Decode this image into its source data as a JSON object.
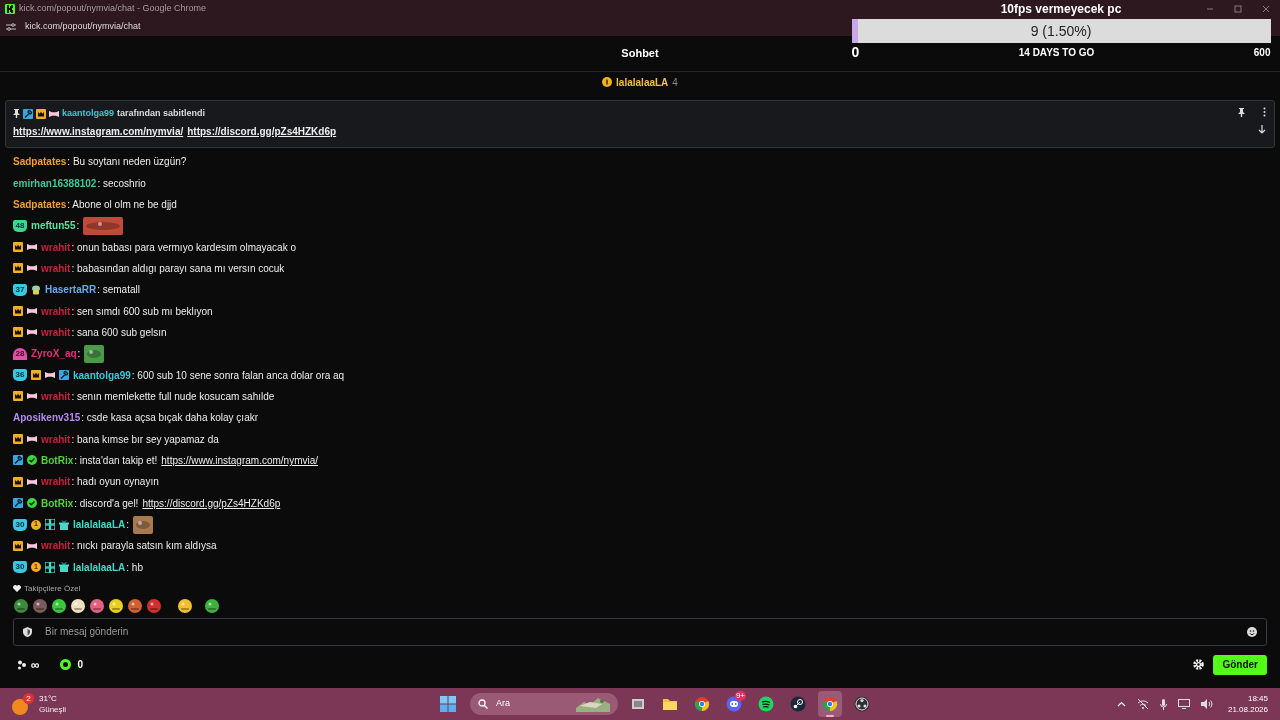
{
  "browser": {
    "title": "kick.com/popout/nymvia/chat - Google Chrome",
    "url": "kick.com/popout/nymvia/chat"
  },
  "goal": {
    "title": "10fps vermeyecek pc",
    "reading": "9 (1.50%)",
    "level": 0.015,
    "min": "0",
    "remaining": "14 DAYS TO GO",
    "max": "600"
  },
  "header": {
    "title": "Sohbet"
  },
  "gifter": {
    "name": "lalalalaaLA",
    "count": "4"
  },
  "pinned": {
    "badges": [
      {
        "kind": "mod"
      },
      {
        "kind": "crown"
      },
      {
        "kind": "ribbon"
      }
    ],
    "user": "kaantolga99",
    "color": "#3cc8d8",
    "note": "tarafından sabitlendi",
    "links": [
      "https://www.instagram.com/nymvia/",
      "https://discord.gg/pZs4HZKd6p"
    ]
  },
  "messages": [
    {
      "user": "Sadpatates",
      "color": "#f0a030",
      "text": ": Bu soytanı neden üzgün?"
    },
    {
      "user": "emirhan16388102",
      "color": "#3fc89a",
      "text": ": secoshrio"
    },
    {
      "user": "Sadpatates",
      "color": "#f0a030",
      "text": ": Abone ol olm ne be djjd"
    },
    {
      "badges": [
        {
          "kind": "sub",
          "label": "48",
          "color": "#3cd890"
        }
      ],
      "user": "meftun55",
      "color": "#5de0a0",
      "text": ":",
      "emote": {
        "color": "#c04a3a"
      }
    },
    {
      "badges": [
        {
          "kind": "crown"
        },
        {
          "kind": "ribbon"
        }
      ],
      "user": "wrahit",
      "color": "#c8203c",
      "text": ": onun babası para vermıyo kardesım olmayacak o"
    },
    {
      "badges": [
        {
          "kind": "crown"
        },
        {
          "kind": "ribbon"
        }
      ],
      "user": "wrahit",
      "color": "#c8203c",
      "text": ": babasından aldıgı parayı sana mı versın cocuk"
    },
    {
      "badges": [
        {
          "kind": "sub",
          "label": "37",
          "color": "#38c8e0"
        },
        {
          "kind": "alien"
        }
      ],
      "user": "HasertaRR",
      "color": "#6aa8f0",
      "text": ": sematall"
    },
    {
      "badges": [
        {
          "kind": "crown"
        },
        {
          "kind": "ribbon"
        }
      ],
      "user": "wrahit",
      "color": "#c8203c",
      "text": ": sen sımdı 600 sub mı beklıyon"
    },
    {
      "badges": [
        {
          "kind": "crown"
        },
        {
          "kind": "ribbon"
        }
      ],
      "user": "wrahit",
      "color": "#c8203c",
      "text": ": sana 600 sub gelsın"
    },
    {
      "badges": [
        {
          "kind": "drop",
          "label": "28",
          "color": "#e050a8"
        }
      ],
      "user": "ZyroX_aq",
      "color": "#e0307a",
      "text": ":",
      "emote": {
        "color": "#4a9a4a"
      }
    },
    {
      "badges": [
        {
          "kind": "sub",
          "label": "36",
          "color": "#38c8e0"
        },
        {
          "kind": "crown"
        },
        {
          "kind": "ribbon"
        },
        {
          "kind": "mod"
        }
      ],
      "user": "kaantolga99",
      "color": "#3cc8d8",
      "text": ": 600 sub 10 sene sonra falan anca dolar ora aq"
    },
    {
      "badges": [
        {
          "kind": "crown"
        },
        {
          "kind": "ribbon"
        }
      ],
      "user": "wrahit",
      "color": "#c8203c",
      "text": ": senın memlekette full nude kosucam sahılde"
    },
    {
      "user": "Aposikenv315",
      "color": "#b48cf0",
      "text": ": csde kasa açsa bıçak daha kolay çıakr"
    },
    {
      "badges": [
        {
          "kind": "crown"
        },
        {
          "kind": "ribbon"
        }
      ],
      "user": "wrahit",
      "color": "#c8203c",
      "text": ": bana kımse bır sey yapamaz da"
    },
    {
      "badges": [
        {
          "kind": "mod"
        },
        {
          "kind": "verified"
        }
      ],
      "user": "BotRix",
      "color": "#52d33a",
      "text": ": insta'dan takip et!",
      "link": "https://www.instagram.com/nymvia/"
    },
    {
      "badges": [
        {
          "kind": "crown"
        },
        {
          "kind": "ribbon"
        }
      ],
      "user": "wrahit",
      "color": "#c8203c",
      "text": ": hadı oyun oynayın"
    },
    {
      "badges": [
        {
          "kind": "mod"
        },
        {
          "kind": "verified"
        }
      ],
      "user": "BotRix",
      "color": "#52d33a",
      "text": ": discord'a gel!",
      "link": "https://discord.gg/pZs4HZKd6p"
    },
    {
      "badges": [
        {
          "kind": "sub",
          "label": "30",
          "color": "#38c8e0"
        },
        {
          "kind": "coin",
          "label": "1"
        },
        {
          "kind": "og"
        },
        {
          "kind": "gift"
        }
      ],
      "user": "lalalalaaLA",
      "color": "#44d8c8",
      "text": ":",
      "emote": {
        "color": "#a87a50"
      }
    },
    {
      "badges": [
        {
          "kind": "crown"
        },
        {
          "kind": "ribbon"
        }
      ],
      "user": "wrahit",
      "color": "#c8203c",
      "text": ": nıckı parayla satsın kım aldıysa"
    },
    {
      "badges": [
        {
          "kind": "sub",
          "label": "30",
          "color": "#38c8e0"
        },
        {
          "kind": "coin",
          "label": "1"
        },
        {
          "kind": "og"
        },
        {
          "kind": "gift"
        }
      ],
      "user": "lalalalaaLA",
      "color": "#44d8c8",
      "text": ": hb"
    }
  ],
  "follower_emotes": {
    "label": "Takipçilere Özel",
    "emotes": [
      {
        "color": "#3c8a3c"
      },
      {
        "color": "#7a5a5a"
      },
      {
        "color": "#3cc83c"
      },
      {
        "color": "#f0e0c0"
      },
      {
        "color": "#e06080"
      },
      {
        "color": "#e8d020"
      },
      {
        "color": "#d06030"
      },
      {
        "color": "#d03030"
      },
      {
        "color": "#f0c030"
      },
      {
        "color": "#40b040"
      }
    ]
  },
  "composer": {
    "placeholder": "Bir mesaj gönderin",
    "loyalty": "∞",
    "points": "0",
    "send": "Gönder"
  },
  "taskbar": {
    "weather": {
      "temp": "31°C",
      "condition": "Güneşli",
      "badge": "2"
    },
    "search": "Ara",
    "apps": [
      {
        "kind": "taskview",
        "selected": false
      },
      {
        "kind": "folder",
        "selected": false
      },
      {
        "kind": "chrome",
        "selected": false
      },
      {
        "kind": "discord",
        "badge": "9+",
        "selected": false
      },
      {
        "kind": "spotify",
        "selected": false
      },
      {
        "kind": "steam",
        "selected": false
      },
      {
        "kind": "chrome",
        "selected": true
      },
      {
        "kind": "obs",
        "selected": false
      }
    ],
    "clock": {
      "time": "18:45",
      "date": "21.08.2026"
    }
  }
}
